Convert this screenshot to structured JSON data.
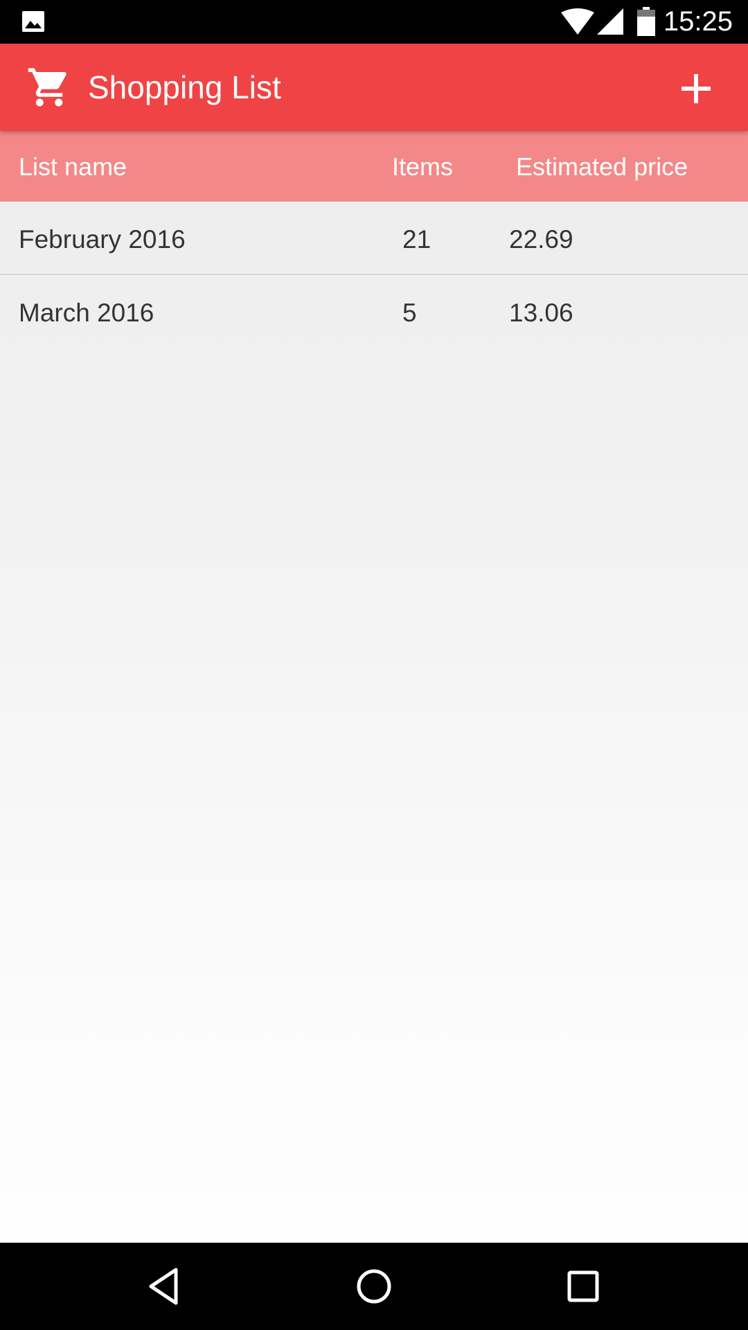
{
  "status_bar": {
    "time": "15:25",
    "icons": [
      "gallery-icon",
      "wifi-icon",
      "signal-icon",
      "battery-icon"
    ]
  },
  "app_bar": {
    "title": "Shopping List",
    "leading_icon": "cart-icon",
    "action_icon": "plus-icon",
    "color": "#f04346"
  },
  "table": {
    "header_color": "#f48888",
    "columns": [
      "List name",
      "Items",
      "Estimated price"
    ],
    "rows": [
      {
        "name": "February 2016",
        "items": "21",
        "price": "22.69"
      },
      {
        "name": "March 2016",
        "items": "5",
        "price": "13.06"
      }
    ]
  },
  "nav_bar": {
    "icons": [
      "back-icon",
      "home-icon",
      "recents-icon"
    ]
  }
}
